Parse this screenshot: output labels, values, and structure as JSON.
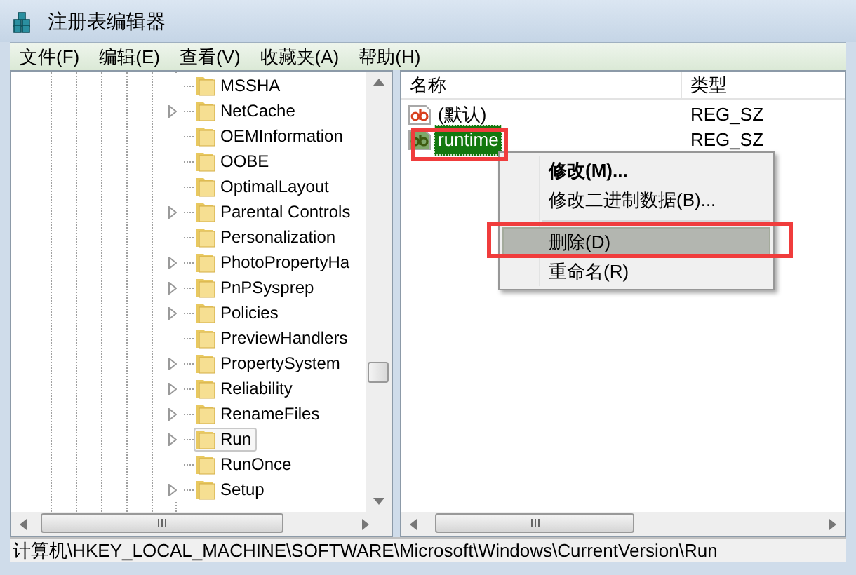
{
  "window": {
    "title": "注册表编辑器"
  },
  "menu": [
    "文件(F)",
    "编辑(E)",
    "查看(V)",
    "收藏夹(A)",
    "帮助(H)"
  ],
  "tree": {
    "items": [
      {
        "label": "MSSHA",
        "expandable": false,
        "selected": false
      },
      {
        "label": "NetCache",
        "expandable": true,
        "selected": false
      },
      {
        "label": "OEMInformation",
        "expandable": false,
        "selected": false
      },
      {
        "label": "OOBE",
        "expandable": false,
        "selected": false
      },
      {
        "label": "OptimalLayout",
        "expandable": false,
        "selected": false
      },
      {
        "label": "Parental Controls",
        "expandable": true,
        "selected": false
      },
      {
        "label": "Personalization",
        "expandable": false,
        "selected": false
      },
      {
        "label": "PhotoPropertyHa",
        "expandable": true,
        "selected": false
      },
      {
        "label": "PnPSysprep",
        "expandable": true,
        "selected": false
      },
      {
        "label": "Policies",
        "expandable": true,
        "selected": false
      },
      {
        "label": "PreviewHandlers",
        "expandable": false,
        "selected": false
      },
      {
        "label": "PropertySystem",
        "expandable": true,
        "selected": false
      },
      {
        "label": "Reliability",
        "expandable": true,
        "selected": false
      },
      {
        "label": "RenameFiles",
        "expandable": true,
        "selected": false
      },
      {
        "label": "Run",
        "expandable": true,
        "selected": true
      },
      {
        "label": "RunOnce",
        "expandable": false,
        "selected": false
      },
      {
        "label": "Setup",
        "expandable": true,
        "selected": false
      }
    ]
  },
  "list": {
    "columns": [
      "名称",
      "类型"
    ],
    "rows": [
      {
        "name": "(默认)",
        "type": "REG_SZ",
        "selected": false
      },
      {
        "name": "runtime",
        "type": "REG_SZ",
        "selected": true
      }
    ]
  },
  "context_menu": {
    "items": [
      {
        "kind": "item",
        "label": "修改(M)...",
        "default": true,
        "selected": false
      },
      {
        "kind": "item",
        "label": "修改二进制数据(B)...",
        "default": false,
        "selected": false
      },
      {
        "kind": "separator"
      },
      {
        "kind": "item",
        "label": "删除(D)",
        "default": false,
        "selected": true
      },
      {
        "kind": "item",
        "label": "重命名(R)",
        "default": false,
        "selected": false
      }
    ]
  },
  "status_bar": "计算机\\HKEY_LOCAL_MACHINE\\SOFTWARE\\Microsoft\\Windows\\CurrentVersion\\Run"
}
